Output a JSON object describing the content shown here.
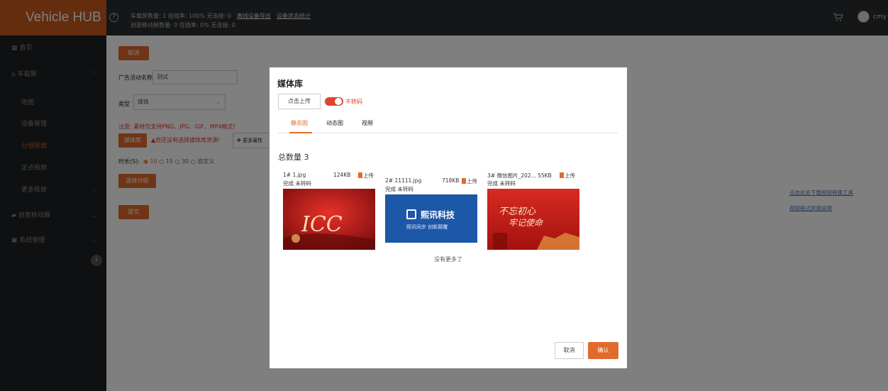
{
  "header": {
    "brand": "Vehicle HUB",
    "help_icon": "help-circle-icon",
    "stats_line1": "车载屏数量: 1 在线率: 100% 无连接: 0",
    "export_link": "离线设备导出",
    "status_link": "设备状态统计",
    "stats_line2": "创意移动屏数量: 0 在线率: 0% 无连接: 0",
    "user": "cmy ▾"
  },
  "sidebar": {
    "items": [
      {
        "label": "首页",
        "icon": "home-icon"
      },
      {
        "label": "车载屏",
        "icon": "car-icon"
      },
      {
        "label": "地图"
      },
      {
        "label": "设备管理"
      },
      {
        "label": "分组投放"
      },
      {
        "label": "定点投放"
      },
      {
        "label": "更多投放"
      },
      {
        "label": "创意移动屏",
        "icon": "screen-icon"
      },
      {
        "label": "系统管理",
        "icon": "settings-icon"
      }
    ],
    "collapse_label": "‹"
  },
  "form": {
    "cancel_label": "取消",
    "name_label": "广告活动名称",
    "name_value": "测试",
    "type_label": "类型",
    "type_value": "媒体",
    "notice": "注意: 素材仅支持PNG、JPG、GIF、MP4格式!",
    "media_lib_label": "媒体库",
    "warning": "▲您还没有选择媒体库资源!",
    "more_label": "✥ 更多属性",
    "duration_label": "时长(S):",
    "durations": [
      "10",
      "15",
      "30",
      "自定义"
    ],
    "select_group_label": "选择分组",
    "submit_label": "提交",
    "link1": "点击此处下载视频转换工具",
    "link2": "视频格式转换说明"
  },
  "modal": {
    "title": "媒体库",
    "upload_label": "点击上传",
    "toggle_label": "不转码",
    "tabs": [
      "静态图",
      "动态图",
      "视频"
    ],
    "total_label": "总数量 3",
    "items": [
      {
        "name": "1# 1.jpg",
        "size": "124KB",
        "upload": "上传",
        "status": "完成 未转码"
      },
      {
        "name": "2# 11111.jpg",
        "size": "718KB",
        "upload": "上传",
        "status": "完成 未转码"
      },
      {
        "name": "3# 微信图片_202... 55KB",
        "size": "",
        "upload": "上传",
        "status": "完成 未转码"
      }
    ],
    "thumb2_title": "熙讯科技",
    "thumb2_sub": "熙讯同步 创新颠覆",
    "no_more": "没有更多了",
    "cancel_label": "取消",
    "confirm_label": "确认"
  },
  "colors": {
    "accent": "#e06a2c",
    "header": "#2b2d31",
    "sidebar": "#1f2023",
    "brand": "#c85a1c"
  }
}
